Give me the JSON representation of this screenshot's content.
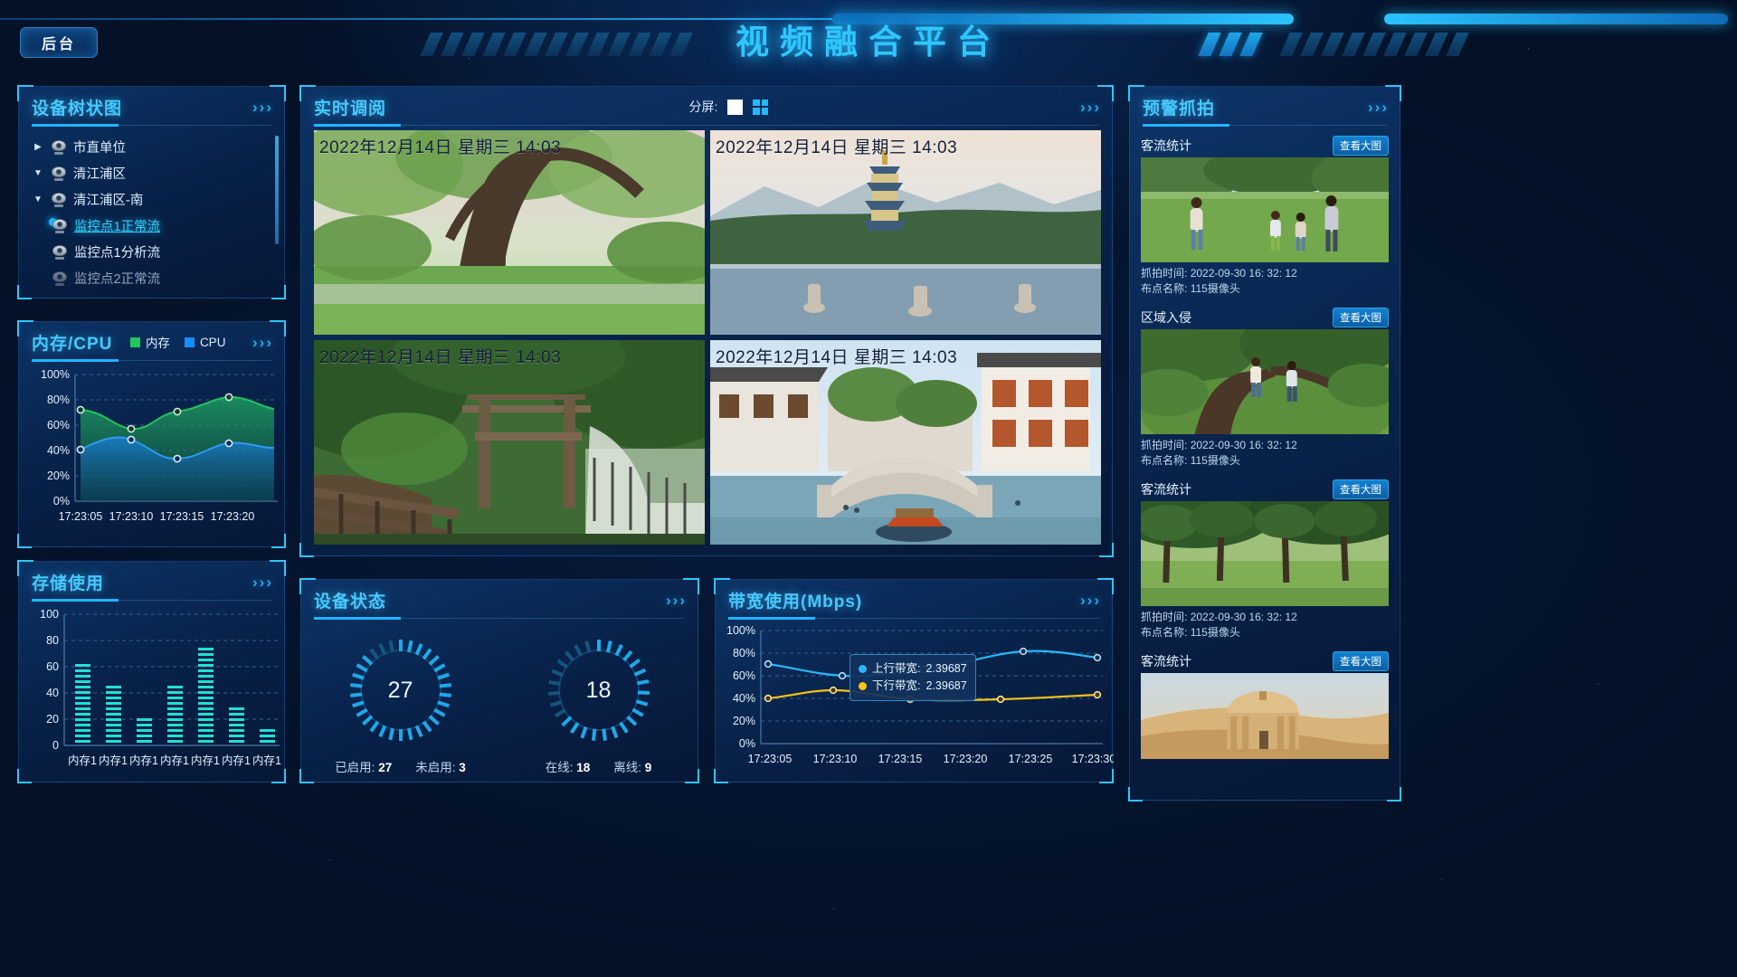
{
  "header": {
    "title": "视频融合平台",
    "backstage_label": "后台"
  },
  "device_tree": {
    "title": "设备树状图",
    "items": [
      {
        "label": "市直单位",
        "depth": 0,
        "arrow": "collapsed",
        "state": "normal"
      },
      {
        "label": "清江浦区",
        "depth": 0,
        "arrow": "expanded",
        "state": "normal"
      },
      {
        "label": "清江浦区-南",
        "depth": 0,
        "arrow": "expanded",
        "state": "normal"
      },
      {
        "label": "监控点1正常流",
        "depth": 1,
        "arrow": "none",
        "state": "selected"
      },
      {
        "label": "监控点1分析流",
        "depth": 1,
        "arrow": "none",
        "state": "normal"
      },
      {
        "label": "监控点2正常流",
        "depth": 1,
        "arrow": "none",
        "state": "offline"
      }
    ]
  },
  "mem_cpu": {
    "title": "内存/CPU",
    "legend": [
      {
        "label": "内存",
        "color": "#22c55e"
      },
      {
        "label": "CPU",
        "color": "#1290ff"
      }
    ]
  },
  "storage": {
    "title": "存储使用"
  },
  "live": {
    "title": "实时调阅",
    "split_label": "分屏:",
    "split_options": [
      "1",
      "4"
    ],
    "split_selected": "4",
    "cells": [
      {
        "timestamp": "2022年12月14日 星期三 14:03",
        "scene": "park-tree"
      },
      {
        "timestamp": "2022年12月14日 星期三 14:03",
        "scene": "pagoda-lake"
      },
      {
        "timestamp": "2022年12月14日 星期三 14:03",
        "scene": "forest-torii"
      },
      {
        "timestamp": "2022年12月14日 星期三 14:03",
        "scene": "canal-bridge"
      }
    ]
  },
  "device_status": {
    "title": "设备状态",
    "gauges": [
      {
        "value": 27,
        "stats": [
          {
            "label": "已启用:",
            "value": "27"
          },
          {
            "label": "未启用:",
            "value": "3"
          }
        ]
      },
      {
        "value": 18,
        "stats": [
          {
            "label": "在线:",
            "value": "18"
          },
          {
            "label": "离线:",
            "value": "9"
          }
        ]
      }
    ]
  },
  "bandwidth": {
    "title": "带宽使用(Mbps)",
    "tooltip": [
      {
        "label": "上行带宽:",
        "value": "2.39687",
        "color": "#29b6f6"
      },
      {
        "label": "下行带宽:",
        "value": "2.39687",
        "color": "#f5c518"
      }
    ]
  },
  "alarm": {
    "title": "预警抓拍",
    "view_label": "查看大图",
    "cards": [
      {
        "name": "客流统计",
        "time_label": "抓拍时间:",
        "time": "2022-09-30  16: 32: 12",
        "point_label": "布点名称:",
        "point": "115摄像头",
        "scene": "family-park"
      },
      {
        "name": "区域入侵",
        "time_label": "抓拍时间:",
        "time": "2022-09-30  16: 32: 12",
        "point_label": "布点名称:",
        "point": "115摄像头",
        "scene": "kids-tree"
      },
      {
        "name": "客流统计",
        "time_label": "抓拍时间:",
        "time": "2022-09-30  16: 32: 12",
        "point_label": "布点名称:",
        "point": "115摄像头",
        "scene": "forest-path"
      },
      {
        "name": "客流统计",
        "time_label": "",
        "time": "",
        "point_label": "",
        "point": "",
        "scene": "desert-temple"
      }
    ]
  },
  "chart_data": [
    {
      "type": "area",
      "title": "内存/CPU",
      "x": [
        "17:23:05",
        "17:23:10",
        "17:23:15",
        "17:23:20"
      ],
      "series": [
        {
          "name": "内存",
          "color": "#22c55e",
          "values": [
            72,
            65,
            65,
            76,
            68
          ]
        },
        {
          "name": "CPU",
          "color": "#1290ff",
          "values": [
            41,
            48,
            35,
            45,
            42
          ]
        }
      ],
      "ylabel": "",
      "yticks": [
        "0%",
        "20%",
        "40%",
        "60%",
        "80%",
        "100%"
      ],
      "ylim": [
        0,
        100
      ],
      "grid": true,
      "legend_position": "top-right"
    },
    {
      "type": "bar",
      "title": "存储使用",
      "categories": [
        "内存1",
        "内存1",
        "内存1",
        "内存1",
        "内存1",
        "内存1",
        "内存1"
      ],
      "values": [
        62,
        45,
        20,
        46,
        75,
        30,
        12
      ],
      "yticks": [
        "0",
        "20",
        "40",
        "60",
        "80",
        "100"
      ],
      "ylim": [
        0,
        100
      ],
      "bar_color": "#1fe0d8",
      "grid": true
    },
    {
      "type": "line",
      "title": "带宽使用(Mbps)",
      "x": [
        "17:23:05",
        "17:23:10",
        "17:23:15",
        "17:23:20",
        "17:23:25",
        "17:23:30"
      ],
      "series": [
        {
          "name": "上行带宽",
          "color": "#29b6f6",
          "values": [
            70,
            62,
            60,
            66,
            75,
            72
          ]
        },
        {
          "name": "下行带宽",
          "color": "#f5c518",
          "values": [
            40,
            47,
            42,
            40,
            41,
            44
          ]
        }
      ],
      "yticks": [
        "0%",
        "20%",
        "40%",
        "60%",
        "80%",
        "100%"
      ],
      "ylim": [
        0,
        100
      ],
      "grid": true
    },
    {
      "type": "gauge",
      "title": "设备状态",
      "gauges": [
        {
          "value": 27,
          "max": 30,
          "color": "#1fa8e8"
        },
        {
          "value": 18,
          "max": 27,
          "color": "#1fa8e8"
        }
      ]
    }
  ]
}
